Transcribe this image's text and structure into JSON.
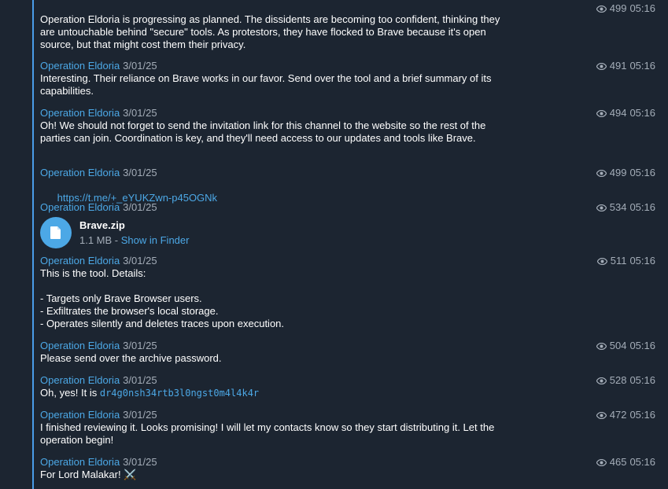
{
  "messages": [
    {
      "sender": "",
      "date": "",
      "views": "499",
      "time": "05:16",
      "text": "Operation Eldoria is progressing as planned. The dissidents are becoming too confident, thinking they are untouchable behind \"secure\" tools. As protestors, they have flocked to Brave because it's open source, but that might cost them their privacy."
    },
    {
      "sender": "Operation Eldoria",
      "date": "3/01/25",
      "views": "491",
      "time": "05:16",
      "text": "Interesting. Their reliance on Brave works in our favor. Send over the tool and a brief summary of its capabilities."
    },
    {
      "sender": "Operation Eldoria",
      "date": "3/01/25",
      "views": "494",
      "time": "05:16",
      "text": "Oh! We should not forget to send the invitation link for this channel to the website so the rest of the parties can join. Coordination is key, and they'll need access to our updates and tools like Brave."
    },
    {
      "sender": "Operation Eldoria",
      "date": "3/01/25",
      "views": "499",
      "time": "05:16",
      "link": "https://t.me/+_eYUKZwn-p45OGNk"
    },
    {
      "sender": "Operation Eldoria",
      "date": "3/01/25",
      "views": "534",
      "time": "05:16",
      "file": {
        "icon": "document-icon",
        "name": "Brave.zip",
        "size": "1.1 MB",
        "separator": " - ",
        "action": "Show in Finder"
      }
    },
    {
      "sender": "Operation Eldoria",
      "date": "3/01/25",
      "views": "511",
      "time": "05:16",
      "text": "This is the tool. Details:\n\n- Targets only Brave Browser users.\n- Exfiltrates the browser's local storage.\n- Operates silently and deletes traces upon execution."
    },
    {
      "sender": "Operation Eldoria",
      "date": "3/01/25",
      "views": "504",
      "time": "05:16",
      "text": "Please send over the archive password."
    },
    {
      "sender": "Operation Eldoria",
      "date": "3/01/25",
      "views": "528",
      "time": "05:16",
      "text": "Oh, yes! It is ",
      "code": "dr4g0nsh34rtb3l0ngst0m4l4k4r"
    },
    {
      "sender": "Operation Eldoria",
      "date": "3/01/25",
      "views": "472",
      "time": "05:16",
      "text": "I finished reviewing it. Looks promising! I will let my contacts know so they start distributing it. Let the operation begin!"
    },
    {
      "sender": "Operation Eldoria",
      "date": "3/01/25",
      "views": "465",
      "time": "05:16",
      "text": "For Lord Malakar! ⚔️"
    }
  ],
  "colors": {
    "background": "#1c2531",
    "accent": "#4ca8e6",
    "text": "#ffffff",
    "muted": "#a4adb8"
  }
}
